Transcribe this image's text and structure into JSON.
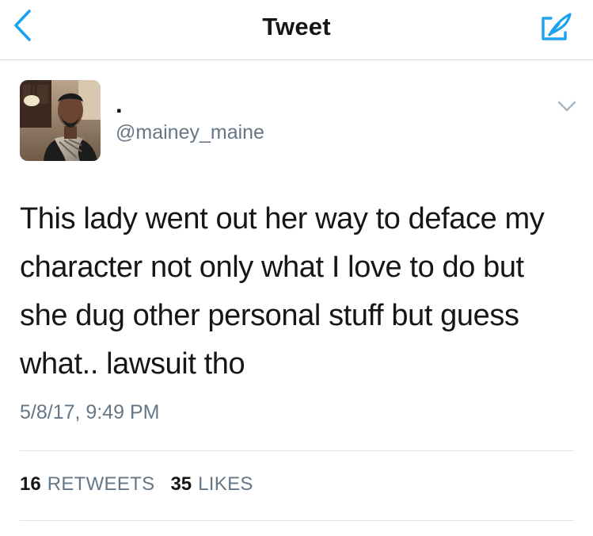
{
  "nav": {
    "title": "Tweet"
  },
  "author": {
    "display_name": ".",
    "handle": "@mainey_maine"
  },
  "tweet": {
    "text": "This lady went out her way to deface my character not only what I love to do but she dug other personal stuff but guess what.. lawsuit tho",
    "timestamp": "5/8/17, 9:49 PM"
  },
  "stats": {
    "retweets_count": "16",
    "retweets_label": "RETWEETS",
    "likes_count": "35",
    "likes_label": "LIKES"
  },
  "colors": {
    "accent": "#1da1f2",
    "text_primary": "#14171a",
    "text_secondary": "#657786",
    "divider": "#dde2e6"
  },
  "icons": {
    "back": "chevron-left-icon",
    "compose": "compose-tweet-icon",
    "caret": "chevron-down-icon"
  }
}
